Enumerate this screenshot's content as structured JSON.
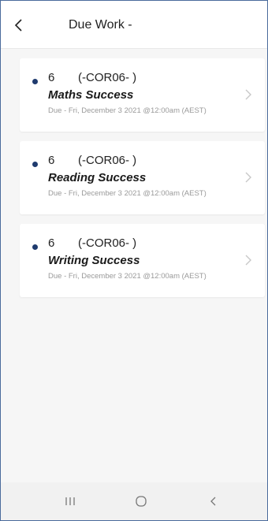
{
  "header": {
    "title": "Due Work -"
  },
  "colors": {
    "dot": "#1f3b6e",
    "chevron": "#c8c8c8"
  },
  "items": [
    {
      "grade": "6",
      "code": "(-COR06- )",
      "subject": "Maths Success",
      "due": "Due - Fri, December 3 2021 @12:00am (AEST)"
    },
    {
      "grade": "6",
      "code": "(-COR06- )",
      "subject": "Reading Success",
      "due": "Due - Fri, December 3 2021 @12:00am (AEST)"
    },
    {
      "grade": "6",
      "code": "(-COR06- )",
      "subject": "Writing Success",
      "due": "Due - Fri, December 3 2021 @12:00am (AEST)"
    }
  ],
  "navbar": {
    "icons": [
      "recent-apps-icon",
      "home-icon",
      "back-icon"
    ]
  }
}
